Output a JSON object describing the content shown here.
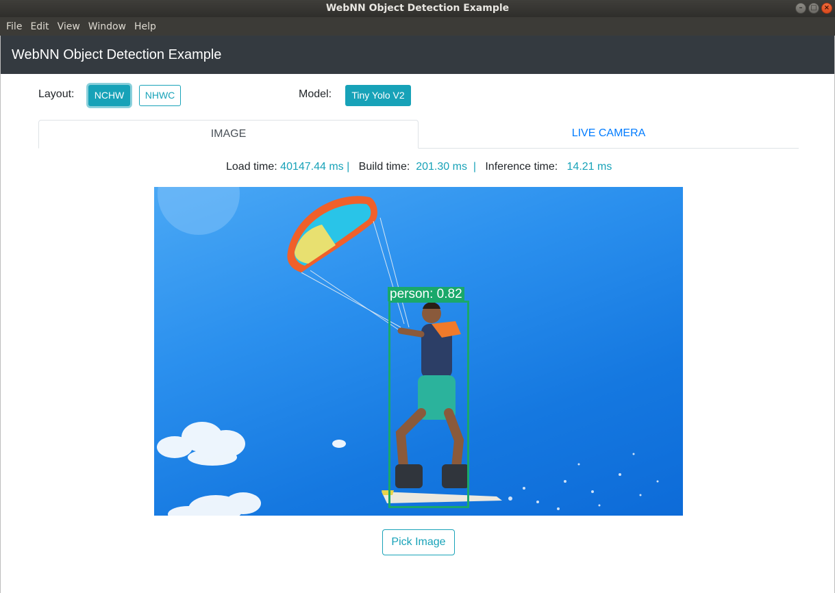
{
  "window": {
    "title": "WebNN Object Detection Example",
    "controls": [
      "minimize",
      "maximize",
      "close"
    ]
  },
  "menubar": {
    "items": [
      "File",
      "Edit",
      "View",
      "Window",
      "Help"
    ]
  },
  "navbar": {
    "title": "WebNN Object Detection Example"
  },
  "controls": {
    "layout_label": "Layout:",
    "layout_options": [
      "NCHW",
      "NHWC"
    ],
    "layout_selected": "NCHW",
    "model_label": "Model:",
    "model_selected": "Tiny Yolo V2"
  },
  "tabs": [
    {
      "label": "IMAGE",
      "active": true
    },
    {
      "label": "LIVE CAMERA",
      "active": false
    }
  ],
  "stats": {
    "load_label": "Load time:",
    "load_value": "40147.44 ms",
    "build_label": "Build time:",
    "build_value": "201.30 ms",
    "inference_label": "Inference time:",
    "inference_value": "14.21 ms",
    "separator": "|"
  },
  "detection": {
    "label": "person: 0.82",
    "color": "#1aa86a"
  },
  "pick_button": {
    "label": "Pick Image"
  },
  "colors": {
    "accent": "#17a2b8",
    "navbar": "#343a40",
    "tab_link": "#007bff"
  }
}
